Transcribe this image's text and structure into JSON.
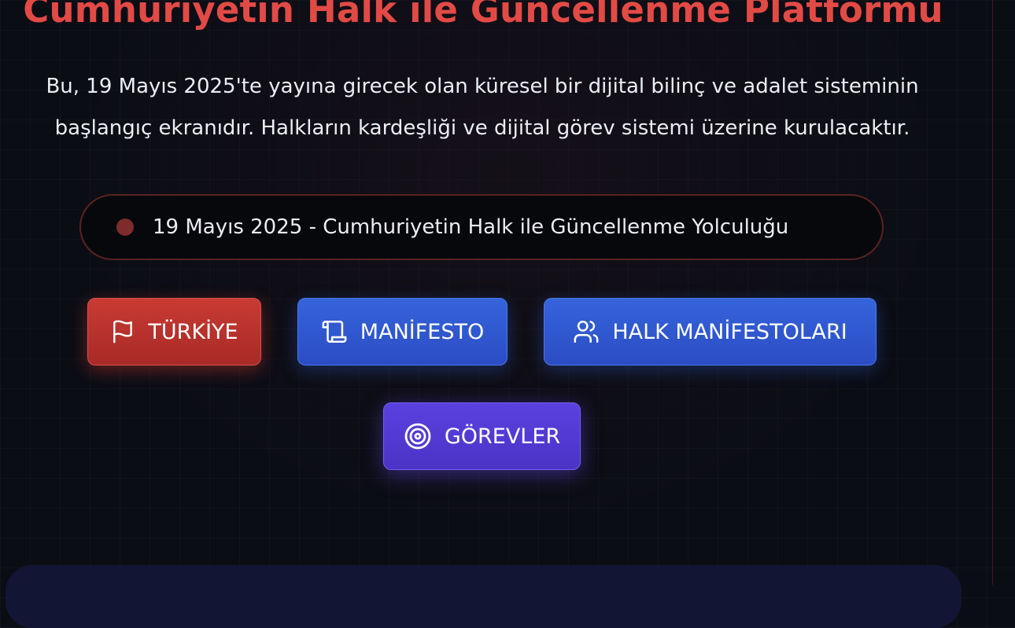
{
  "header": {
    "title": "Cumhuriyetin Halk ile Güncellenme Platformu"
  },
  "intro": {
    "line1": "Bu, 19 Mayıs 2025'te yayına girecek olan küresel bir dijital bilinç ve adalet sisteminin",
    "line2": "başlangıç ekranıdır. Halkların kardeşliği ve dijital görev sistemi üzerine kurulacaktır."
  },
  "date_pill": {
    "text": "19 Mayıs 2025 - Cumhuriyetin Halk ile Güncellenme Yolculuğu",
    "dot_color": "#7e2b2b"
  },
  "nav_buttons": [
    {
      "label": "TÜRKİYE",
      "icon": "flag-icon",
      "color": "#c0362f"
    },
    {
      "label": "MANİFESTO",
      "icon": "scroll-icon",
      "color": "#3158d6"
    },
    {
      "label": "HALK MANİFESTOLARI",
      "icon": "users-icon",
      "color": "#3158d6"
    },
    {
      "label": "GÖREVLER",
      "icon": "target-icon",
      "color": "#5238d4"
    }
  ],
  "colors": {
    "accent_red": "#e24a46",
    "background": "#0b0d15"
  }
}
